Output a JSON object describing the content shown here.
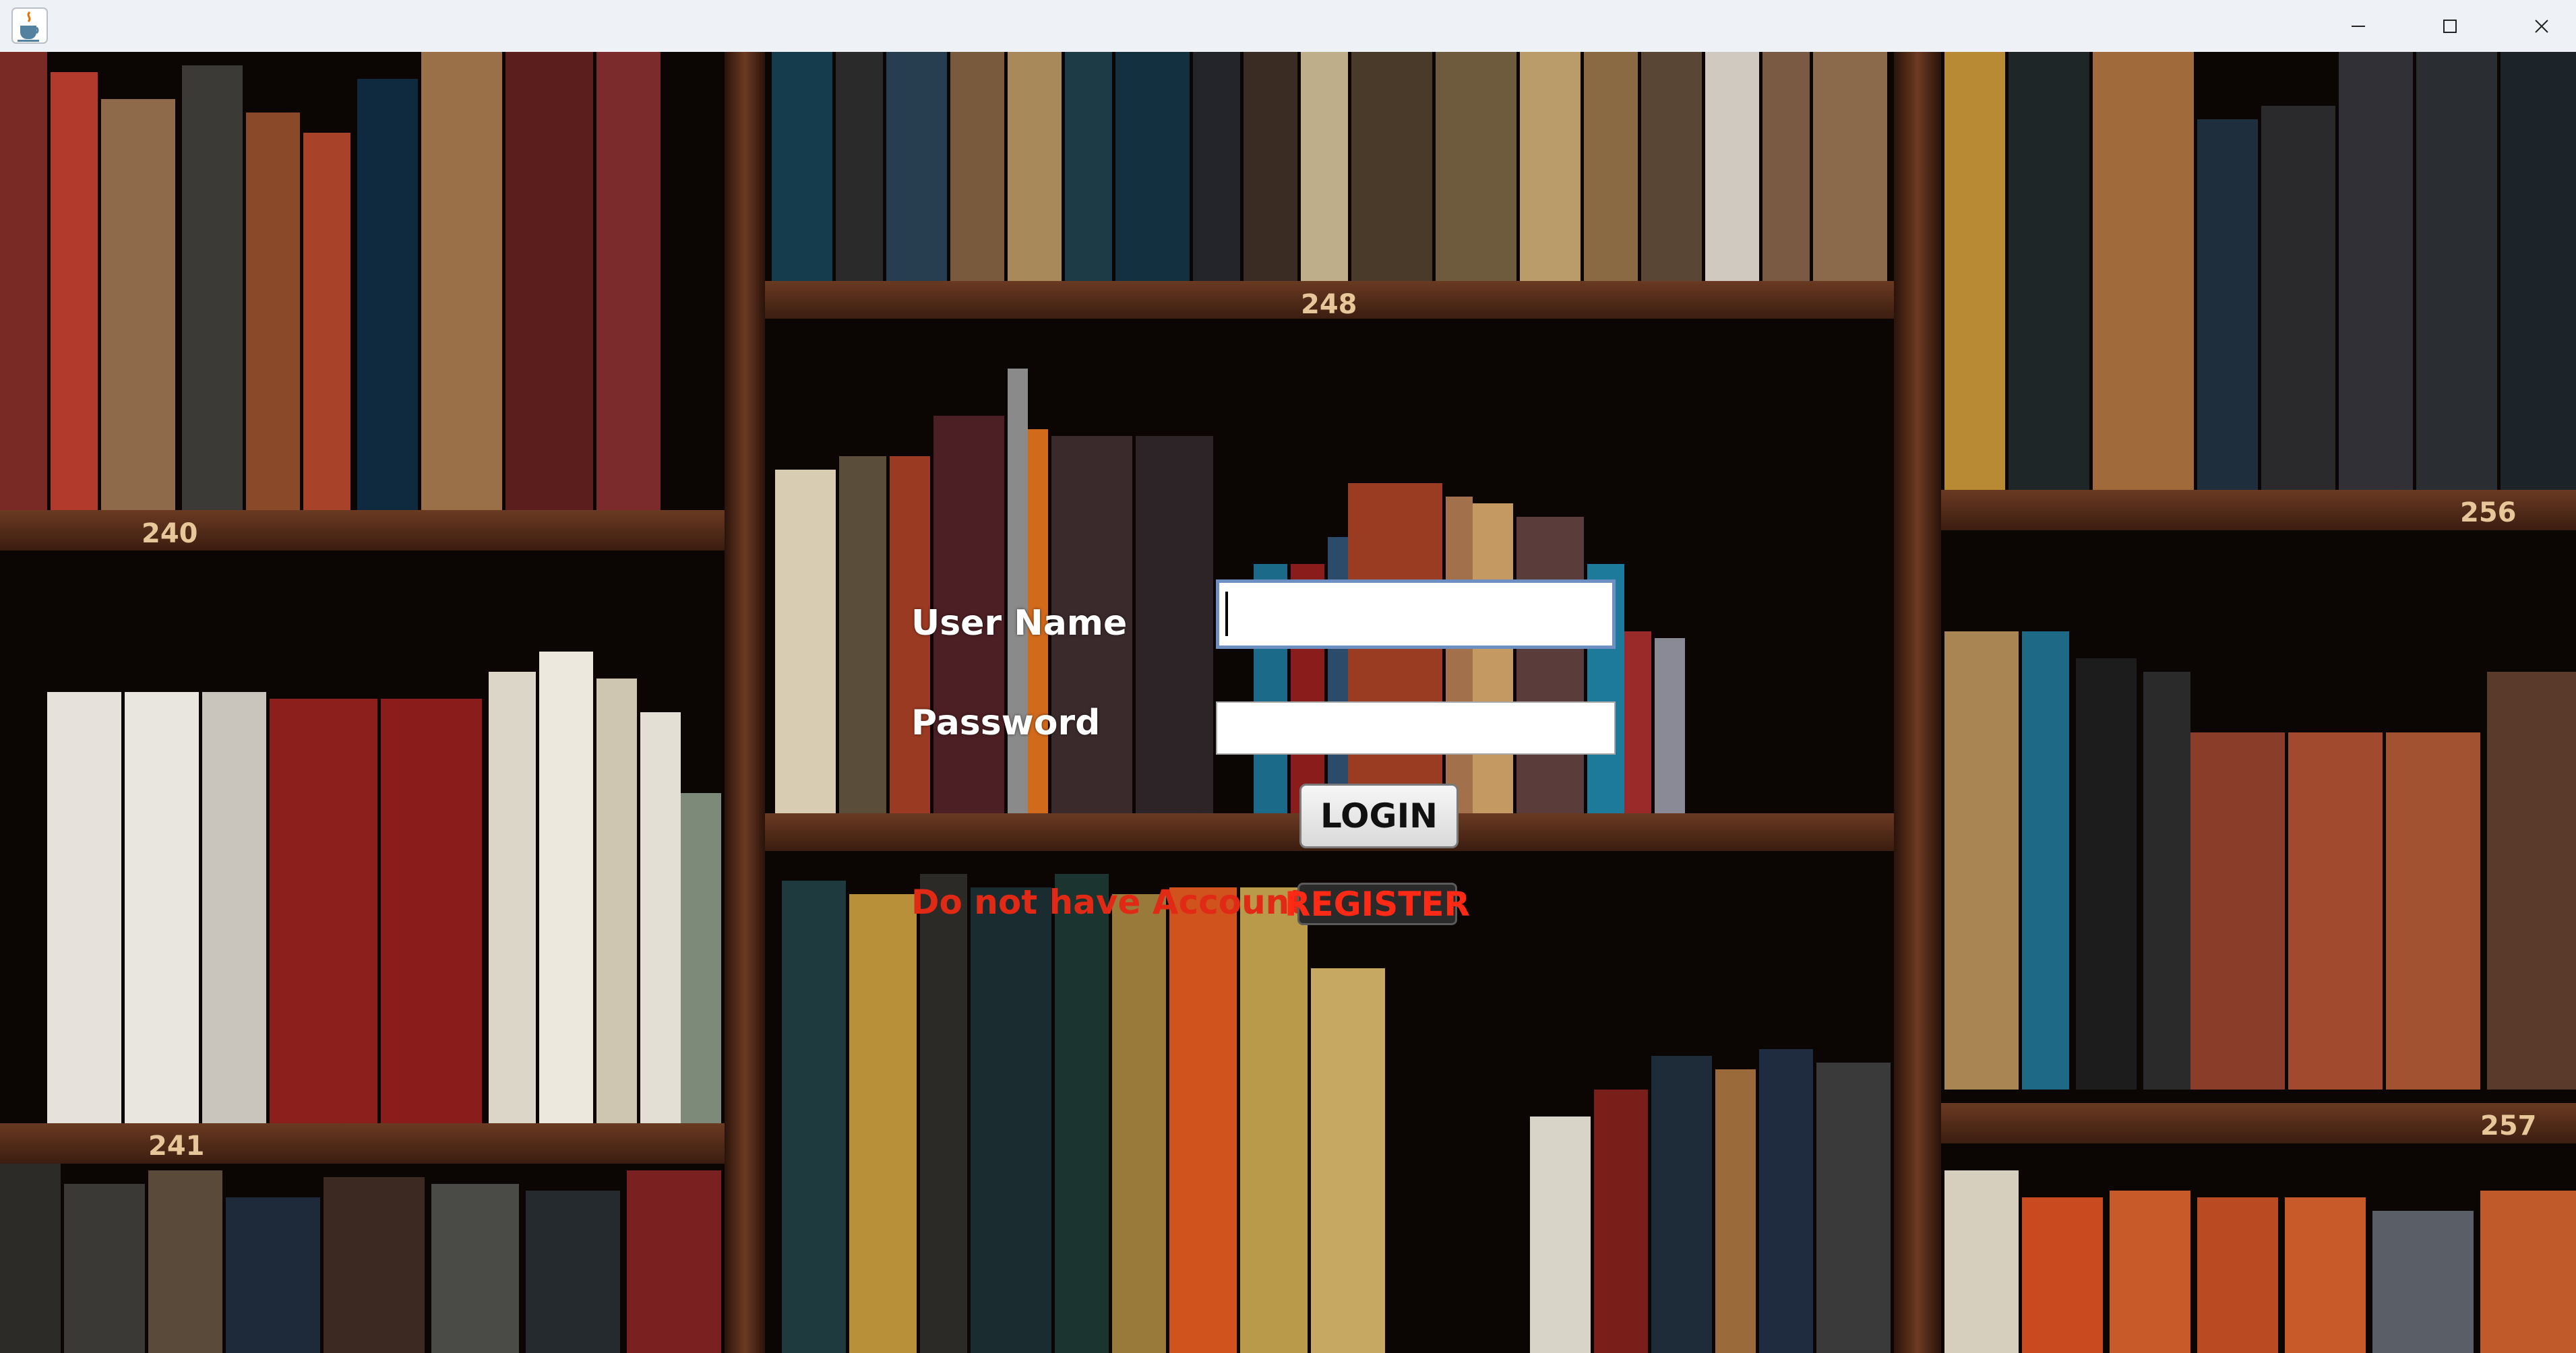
{
  "window": {
    "app_icon": "java-cup-icon",
    "controls": [
      "minimize-icon",
      "maximize-icon",
      "close-icon"
    ]
  },
  "background": {
    "shelf_numbers": [
      "248",
      "240",
      "256",
      "241",
      "257"
    ]
  },
  "form": {
    "username_label": "User Name",
    "username_value": "",
    "password_label": "Password",
    "password_value": "",
    "login_label": "LOGIN",
    "register_prompt": "Do not have Account?",
    "register_label": "REGISTER"
  },
  "colors": {
    "prompt_red": "#e02a16",
    "titlebar": "#eef1f6"
  }
}
